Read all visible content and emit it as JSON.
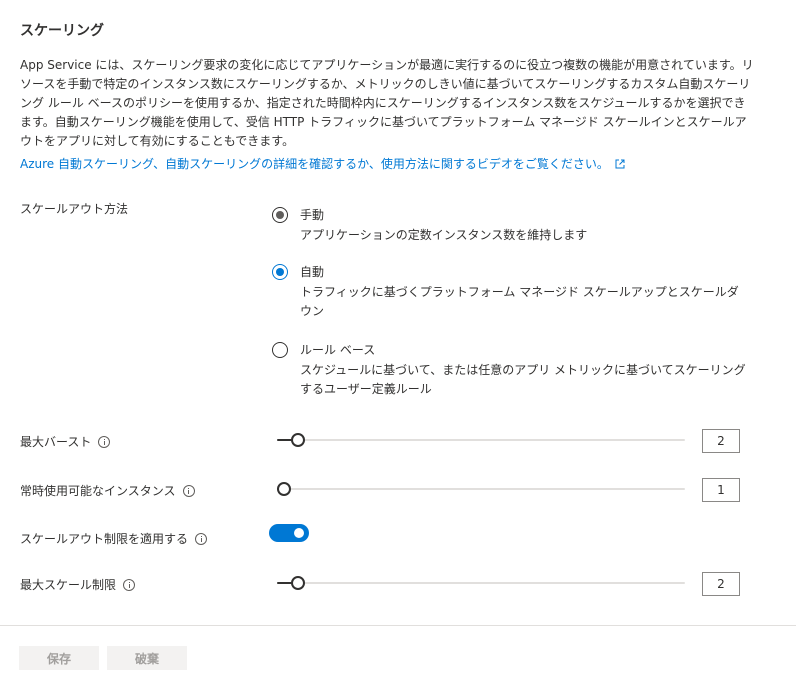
{
  "section": {
    "title": "スケーリング",
    "description": "App Service には、スケーリング要求の変化に応じてアプリケーションが最適に実行するのに役立つ複数の機能が用意されています。リソースを手動で特定のインスタンス数にスケーリングするか、メトリックのしきい値に基づいてスケーリングするカスタム自動スケーリング ルール ベースのポリシーを使用するか、指定された時間枠内にスケーリングするインスタンス数をスケジュールするかを選択できます。自動スケーリング機能を使用して、受信 HTTP トラフィックに基づいてプラットフォーム マネージド スケールインとスケールアウトをアプリに対して有効にすることもできます。",
    "learn_more_link": "Azure 自動スケーリング、自動スケーリングの詳細を確認するか、使用方法に関するビデオをご覧ください。"
  },
  "scale_out_method": {
    "label": "スケールアウト方法",
    "selected": "auto",
    "options": [
      {
        "id": "manual",
        "title": "手動",
        "description": "アプリケーションの定数インスタンス数を維持します"
      },
      {
        "id": "auto",
        "title": "自動",
        "description": "トラフィックに基づくプラットフォーム マネージド スケールアップとスケールダウン"
      },
      {
        "id": "rule",
        "title": "ルール ベース",
        "description": "スケジュールに基づいて、または任意のアプリ メトリックに基づいてスケーリングするユーザー定義ルール"
      }
    ]
  },
  "max_burst": {
    "label": "最大バースト",
    "value": "2",
    "slider_fraction": 0.035
  },
  "always_ready_instances": {
    "label": "常時使用可能なインスタンス",
    "value": "1",
    "slider_fraction": 0.0
  },
  "enforce_scale_out_limit": {
    "label": "スケールアウト制限を適用する",
    "enabled": true
  },
  "max_scale_limit": {
    "label": "最大スケール制限",
    "value": "2",
    "slider_fraction": 0.035
  },
  "actions": {
    "save_label": "保存",
    "discard_label": "破棄"
  },
  "colors": {
    "accent": "#0078d4",
    "text": "#323130",
    "disabled_text": "#a19f9d",
    "disabled_bg": "#f3f2f1"
  }
}
